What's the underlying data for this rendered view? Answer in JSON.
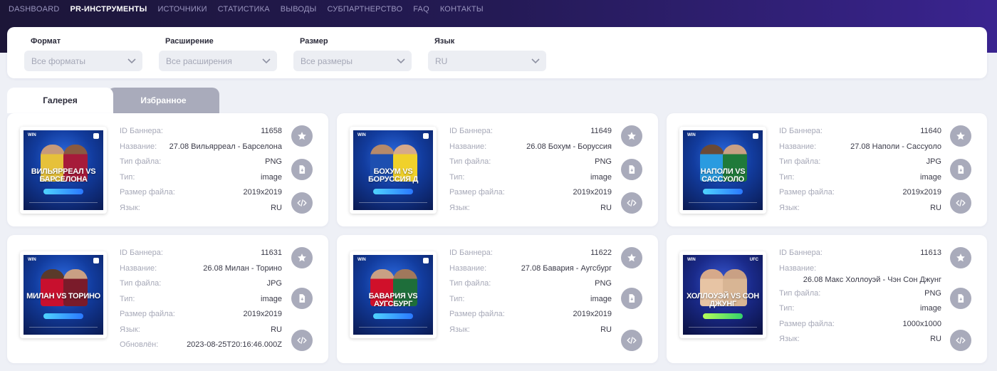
{
  "nav": [
    {
      "label": "DASHBOARD",
      "active": false
    },
    {
      "label": "PR-ИНСТРУМЕНТЫ",
      "active": true
    },
    {
      "label": "ИСТОЧНИКИ",
      "active": false
    },
    {
      "label": "СТАТИСТИКА",
      "active": false
    },
    {
      "label": "ВЫВОДЫ",
      "active": false
    },
    {
      "label": "СУБПАРТНЕРСТВО",
      "active": false
    },
    {
      "label": "FAQ",
      "active": false
    },
    {
      "label": "КОНТАКТЫ",
      "active": false
    }
  ],
  "filters": [
    {
      "label": "Формат",
      "value": "Все форматы"
    },
    {
      "label": "Расширение",
      "value": "Все расширения"
    },
    {
      "label": "Размер",
      "value": "Все размеры"
    },
    {
      "label": "Язык",
      "value": "RU"
    }
  ],
  "tabs": {
    "gallery": "Галерея",
    "favorites": "Избранное"
  },
  "labels": {
    "id": "ID Баннера:",
    "name": "Название:",
    "filetype": "Тип файла:",
    "filetype_alt": "Тип файла:",
    "type": "Тип:",
    "size": "Размер файла:",
    "lang": "Язык:",
    "updated": "Обновлён:"
  },
  "banners": [
    {
      "id": "11658",
      "name": "27.08 Вильярреал - Барселона",
      "filetype": "PNG",
      "type": "image",
      "size": "2019x2019",
      "lang": "RU",
      "thumb_title": "ВИЛЬЯРРЕАЛ VS БАРСЕЛОНА",
      "thumb_logo": "WIN"
    },
    {
      "id": "11649",
      "name": "26.08 Бохум - Боруссия",
      "filetype": "PNG",
      "type": "image",
      "size": "2019x2019",
      "lang": "RU",
      "thumb_title": "БОХУМ VS БОРУССИЯ Д",
      "thumb_logo": "WIN"
    },
    {
      "id": "11640",
      "name": "27.08 Наполи - Сассуоло",
      "filetype": "JPG",
      "type": "image",
      "size": "2019x2019",
      "lang": "RU",
      "thumb_title": "НАПОЛИ VS САССУОЛО",
      "thumb_logo": "WIN"
    },
    {
      "id": "11631",
      "name": "26.08 Милан - Торино",
      "filetype": "JPG",
      "type": "image",
      "size": "2019x2019",
      "lang": "RU",
      "updated": "2023-08-25T20:16:46.000Z",
      "thumb_title": "МИЛАН VS ТОРИНО",
      "thumb_logo": "WIN"
    },
    {
      "id": "11622",
      "name": "27.08 Бавария - Аугсбург",
      "filetype": "PNG",
      "type": "image",
      "size": "2019x2019",
      "lang": "RU",
      "thumb_title": "БАВАРИЯ VS АУГСБУРГ",
      "thumb_logo": "WIN"
    },
    {
      "id": "11613",
      "name": "26.08 Макс Холлоуэй - Чэн Сон Джунг",
      "filetype": "PNG",
      "type": "image",
      "size": "1000x1000",
      "lang": "RU",
      "thumb_title": "ХОЛЛОУЭЙ VS СОН ДЖУНГ",
      "thumb_logo": "WIN",
      "thumb_badge": "UFC"
    }
  ],
  "colors": {
    "accent": "#3a2490",
    "button": "#a9abbb",
    "header": "#1c1638"
  },
  "icons": [
    "chevron-down-icon",
    "star-icon",
    "file-download-icon",
    "code-icon"
  ]
}
